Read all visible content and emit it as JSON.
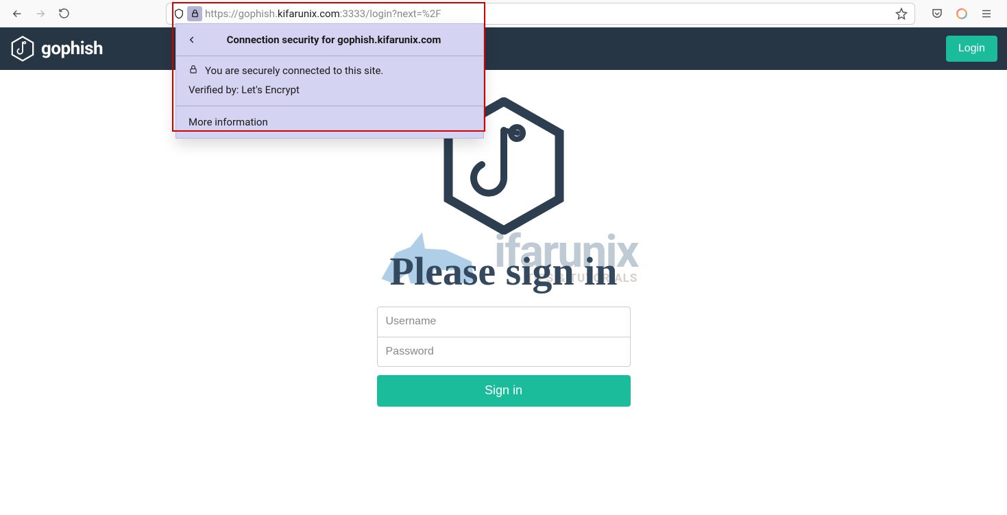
{
  "browser": {
    "url_prefix": "https://gophish.",
    "url_host_dark": "kifarunix.com",
    "url_suffix": ":3333/login?next=%2F"
  },
  "security_popup": {
    "title": "Connection security for gophish.kifarunix.com",
    "line1": "You are securely connected to this site.",
    "line2": "Verified by: Let's Encrypt",
    "more": "More information"
  },
  "nav": {
    "brand": "gophish",
    "login_label": "Login"
  },
  "watermark": {
    "title": "ifarunix",
    "subtitle": "TIPS & TUTORIALS"
  },
  "login_form": {
    "heading": "Please sign in",
    "username_placeholder": "Username",
    "password_placeholder": "Password",
    "submit_label": "Sign in"
  }
}
